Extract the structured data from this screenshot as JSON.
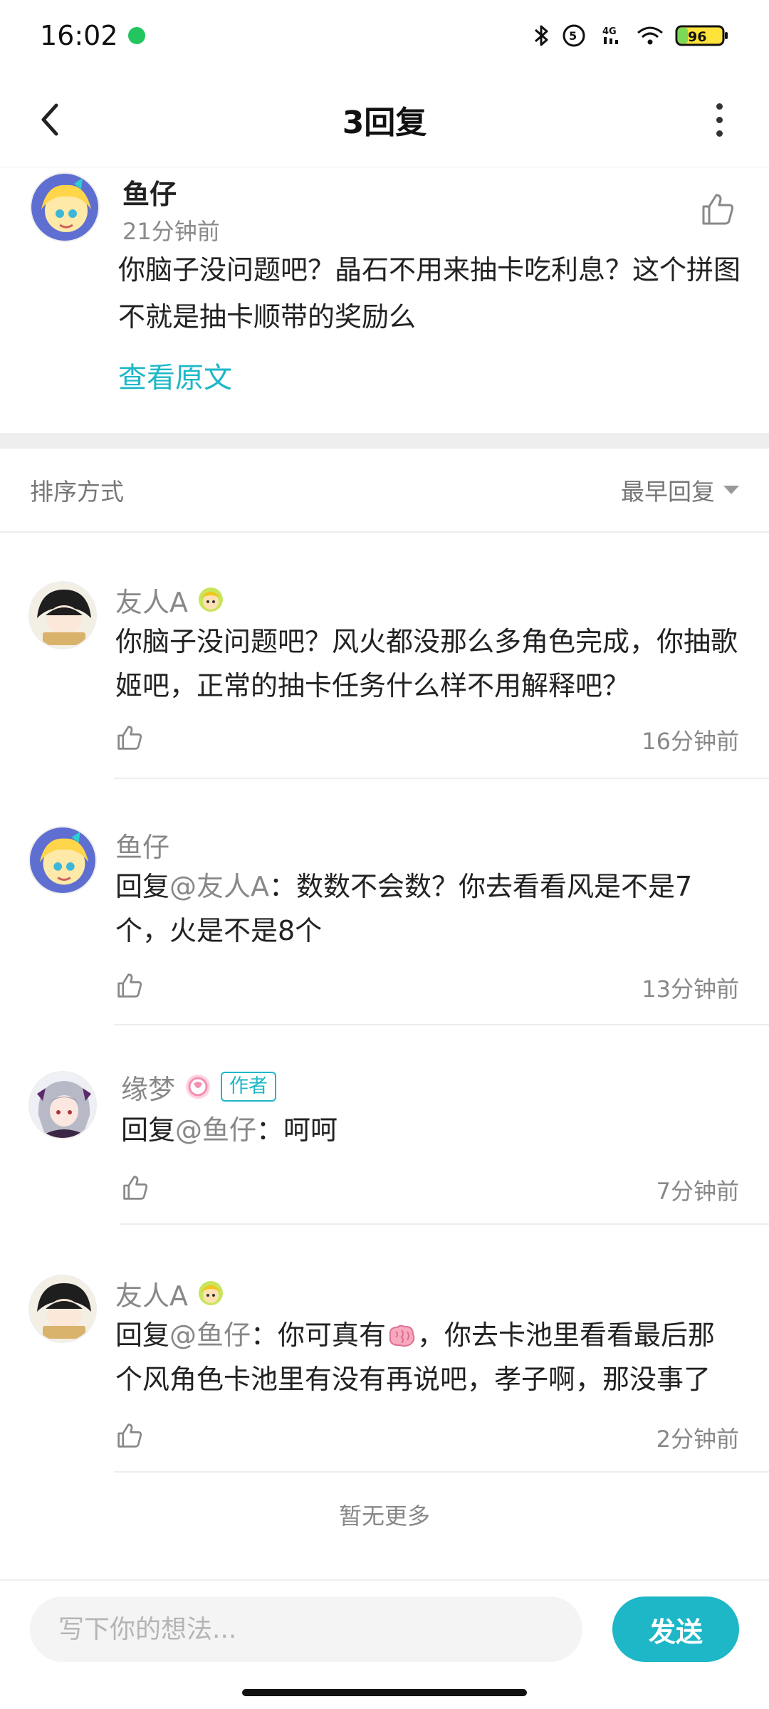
{
  "status_bar": {
    "time": "16:02",
    "battery": "96"
  },
  "nav": {
    "title": "3回复"
  },
  "original": {
    "user": "鱼仔",
    "time": "21分钟前",
    "text": "你脑子没问题吧？晶石不用来抽卡吃利息？这个拼图不就是抽卡顺带的奖励么",
    "view_original": "查看原文"
  },
  "sort": {
    "label": "排序方式",
    "selected": "最早回复"
  },
  "replies": [
    {
      "user": "友人A",
      "reply_to": "",
      "text": "你脑子没问题吧？风火都没那么多角色完成，你抽歌姬吧，正常的抽卡任务什么样不用解释吧？",
      "time": "16分钟前"
    },
    {
      "user": "鱼仔",
      "reply_prefix": "回复",
      "reply_to": "@友人A",
      "text": "：数数不会数？你去看看风是不是7个，火是不是8个",
      "time": "13分钟前"
    },
    {
      "user": "缘梦",
      "author_tag": "作者",
      "reply_prefix": "回复",
      "reply_to": "@鱼仔",
      "text": "：呵呵",
      "time": "7分钟前"
    },
    {
      "user": "友人A",
      "reply_prefix": "回复",
      "reply_to": "@鱼仔",
      "text_a": "：你可真有",
      "text_b": "，你去卡池里看看最后那个风角色卡池里有没有再说吧，孝子啊，那没事了",
      "time": "2分钟前"
    }
  ],
  "footer": {
    "no_more": "暂无更多"
  },
  "input": {
    "placeholder": "写下你的想法...",
    "send_label": "发送"
  },
  "colors": {
    "accent": "#1db7c7"
  }
}
